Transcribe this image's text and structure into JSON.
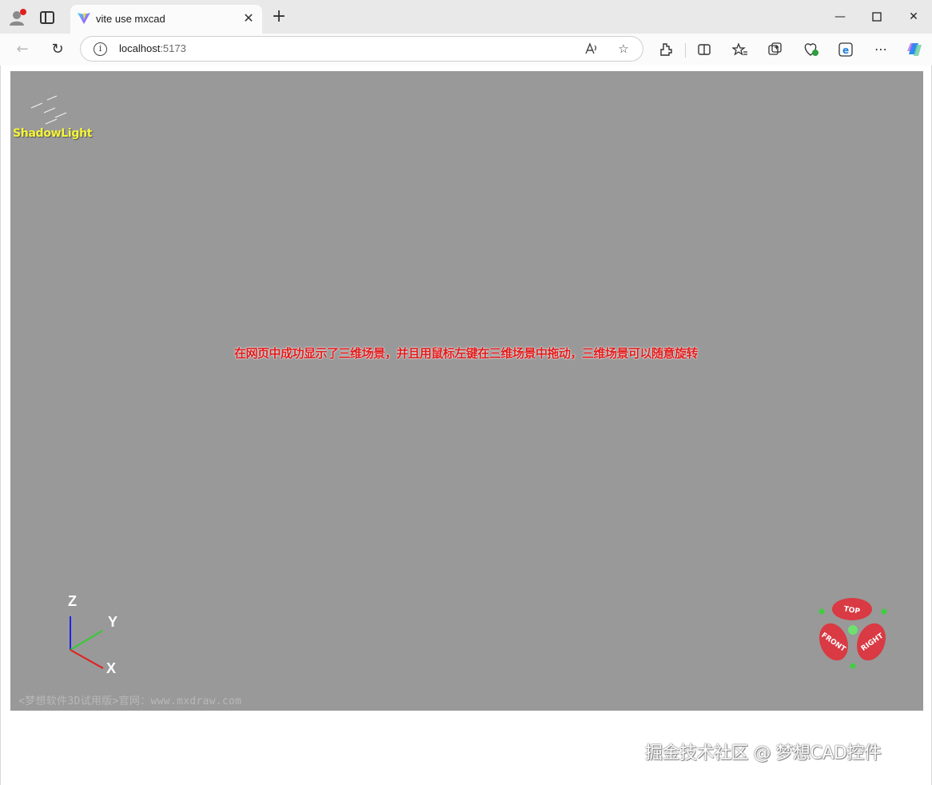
{
  "browser": {
    "tab_title": "vite use mxcad",
    "url_host": "localhost",
    "url_port": ":5173"
  },
  "page": {
    "brand": "ShadowLight",
    "caption": "在网页中成功显示了三维场景，并且用鼠标左键在三维场景中拖动，三维场景可以随意旋转",
    "axis_labels": {
      "x": "X",
      "y": "Y",
      "z": "Z"
    },
    "watermark": "<梦想软件3D试用版>官网：www.mxdraw.com",
    "viewcube": {
      "top": "TOP",
      "front": "FRONT",
      "right": "RIGHT"
    },
    "footer_brand": "掘金技术社区 @ 梦想CAD控件"
  },
  "colors": {
    "viewport_bg": "#999999",
    "caption": "#e01b1b",
    "brand": "#f5f53a",
    "viewcube_face": "#d93a43",
    "viewcube_dot": "#3ecf3e",
    "axis_x": "#e02020",
    "axis_y": "#33cc33",
    "axis_z": "#2020ee"
  }
}
